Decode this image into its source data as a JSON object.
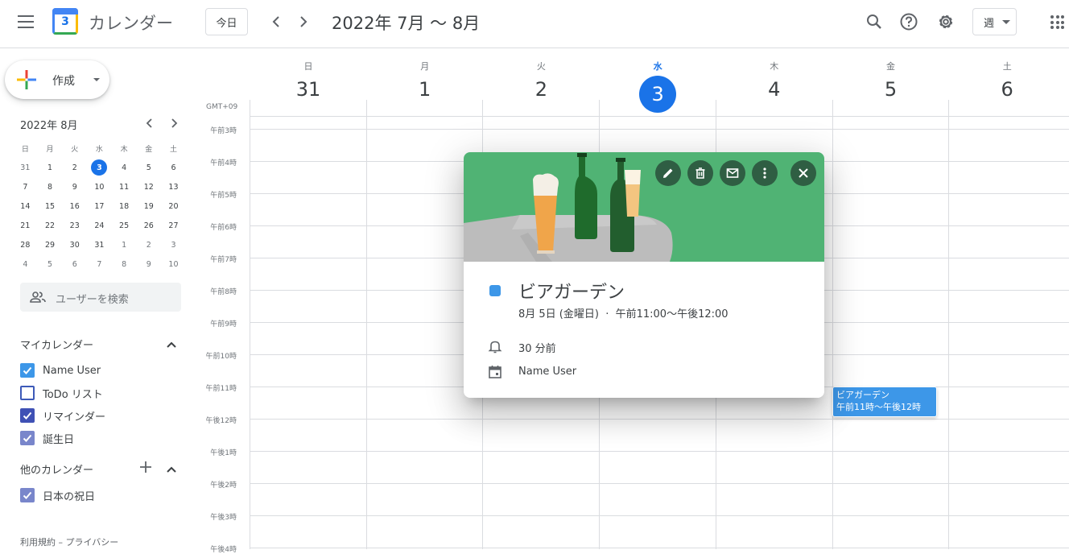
{
  "header": {
    "app_title": "カレンダー",
    "logo_day": "3",
    "today_label": "今日",
    "date_range": "2022年 7月 〜 8月",
    "view_label": "週"
  },
  "sidebar": {
    "create_label": "作成",
    "mini_calendar": {
      "title": "2022年 8月",
      "dow": [
        "日",
        "月",
        "火",
        "水",
        "木",
        "金",
        "土"
      ],
      "weeks": [
        [
          "31",
          "1",
          "2",
          "3",
          "4",
          "5",
          "6"
        ],
        [
          "7",
          "8",
          "9",
          "10",
          "11",
          "12",
          "13"
        ],
        [
          "14",
          "15",
          "16",
          "17",
          "18",
          "19",
          "20"
        ],
        [
          "21",
          "22",
          "23",
          "24",
          "25",
          "26",
          "27"
        ],
        [
          "28",
          "29",
          "30",
          "31",
          "1",
          "2",
          "3"
        ],
        [
          "4",
          "5",
          "6",
          "7",
          "8",
          "9",
          "10"
        ]
      ]
    },
    "search_people_placeholder": "ユーザーを検索",
    "my_calendars_title": "マイカレンダー",
    "my_calendars": [
      {
        "name": "Name User",
        "checked": true,
        "color": "#3d97e8"
      },
      {
        "name": "ToDo リスト",
        "checked": false,
        "color": "#3d5ab8"
      },
      {
        "name": "リマインダー",
        "checked": true,
        "color": "#3f51b5"
      },
      {
        "name": "誕生日",
        "checked": true,
        "color": "#7986cb"
      }
    ],
    "other_calendars_title": "他のカレンダー",
    "other_calendars": [
      {
        "name": "日本の祝日",
        "checked": true,
        "color": "#7986cb"
      }
    ],
    "footer": "利用規約 – プライバシー"
  },
  "week": {
    "timezone": "GMT+09",
    "days": [
      {
        "dow": "日",
        "num": "31",
        "today": false
      },
      {
        "dow": "月",
        "num": "1",
        "today": false
      },
      {
        "dow": "火",
        "num": "2",
        "today": false
      },
      {
        "dow": "水",
        "num": "3",
        "today": true
      },
      {
        "dow": "木",
        "num": "4",
        "today": false
      },
      {
        "dow": "金",
        "num": "5",
        "today": false
      },
      {
        "dow": "土",
        "num": "6",
        "today": false
      }
    ],
    "hours": [
      "午前3時",
      "午前4時",
      "午前5時",
      "午前6時",
      "午前7時",
      "午前8時",
      "午前9時",
      "午前10時",
      "午前11時",
      "午後12時",
      "午後1時",
      "午後2時",
      "午後3時",
      "午後4時"
    ]
  },
  "event_chip": {
    "title": "ビアガーデン",
    "time": "午前11時～午後12時"
  },
  "popup": {
    "title": "ビアガーデン",
    "datetime": "8月 5日 (金曜日)  ·  午前11:00～午後12:00",
    "reminder": "30 分前",
    "calendar": "Name User",
    "color": "#3d97e8",
    "banner_color": "#50b374"
  }
}
